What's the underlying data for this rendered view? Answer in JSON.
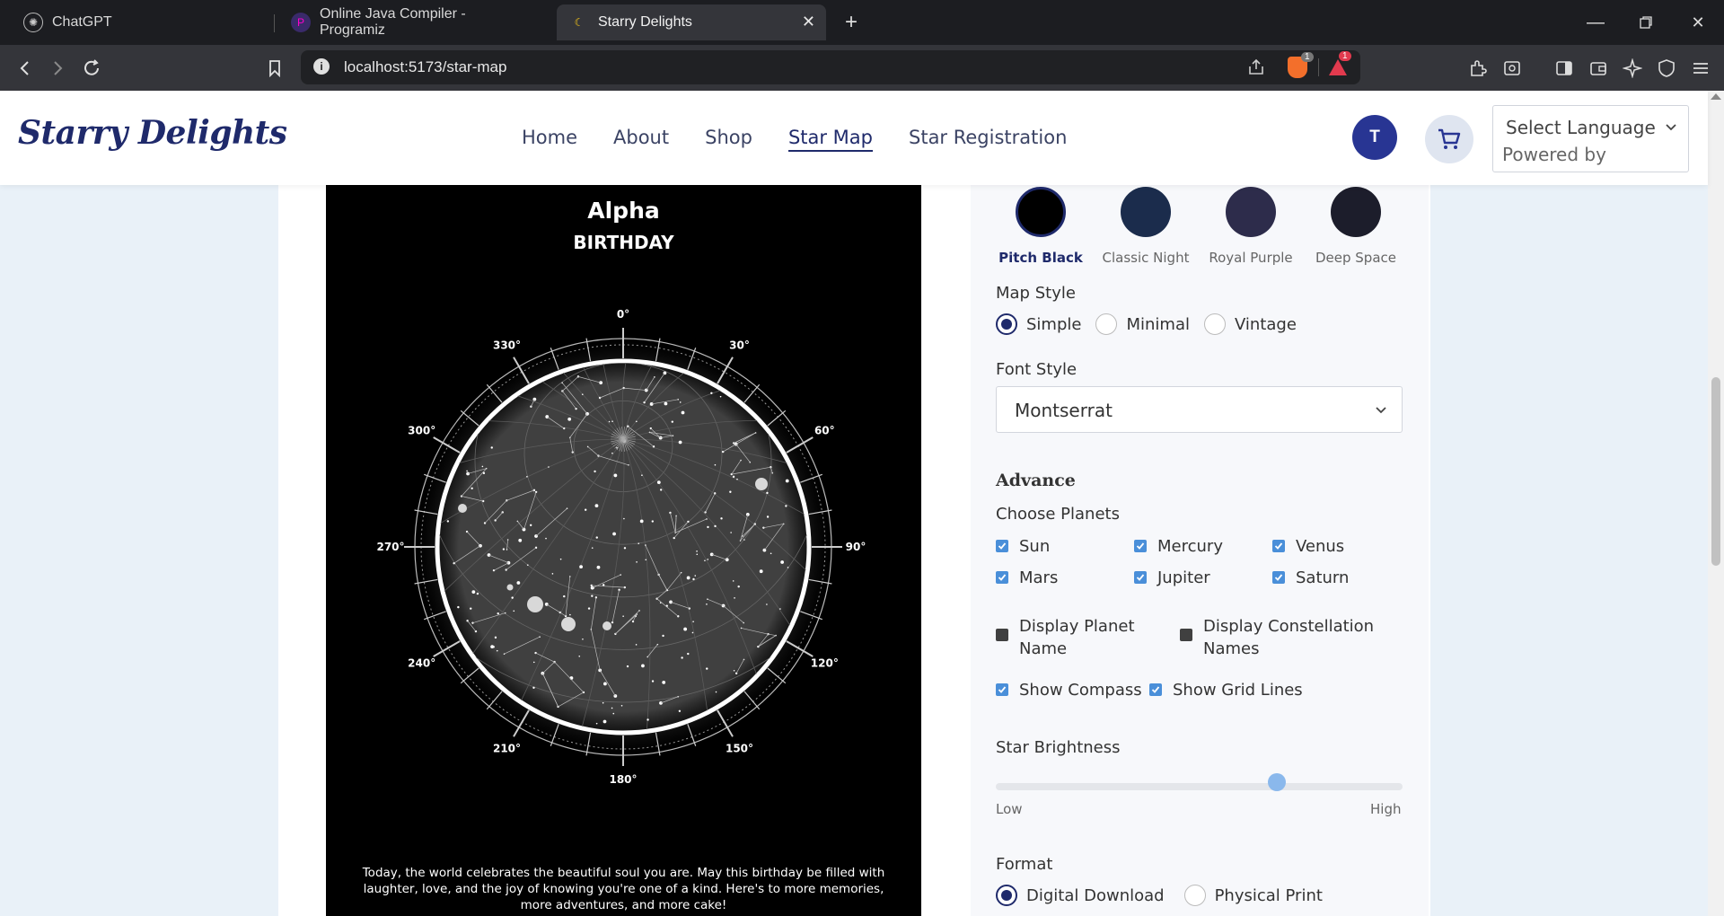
{
  "browser": {
    "tabs": [
      {
        "title": "ChatGPT"
      },
      {
        "title": "Online Java Compiler - Programiz"
      },
      {
        "title": "Starry Delights"
      }
    ],
    "url": "localhost:5173/star-map",
    "brave_badge": "1",
    "alert_badge": "1"
  },
  "site": {
    "logo": "Starry Delights",
    "nav": [
      "Home",
      "About",
      "Shop",
      "Star Map",
      "Star Registration"
    ],
    "active_nav": "Star Map",
    "avatar_letter": "T",
    "language_select": "Select Language",
    "powered_by": "Powered by"
  },
  "poster": {
    "title": "Alpha",
    "subtitle": "BIRTHDAY",
    "message": "Today, the world celebrates the beautiful soul you are. May this birthday be filled with laughter, love, and the joy of knowing you're one of a kind. Here's to more memories, more adventures, and more cake!",
    "compass_labels": [
      "0°",
      "30°",
      "60°",
      "90°",
      "120°",
      "150°",
      "180°",
      "210°",
      "240°",
      "270°",
      "300°",
      "330°"
    ]
  },
  "panel": {
    "themes": [
      {
        "label": "Pitch Black",
        "color": "#000000",
        "selected": true
      },
      {
        "label": "Classic Night",
        "color": "#1b2c4c",
        "selected": false
      },
      {
        "label": "Royal Purple",
        "color": "#2d2c4b",
        "selected": false
      },
      {
        "label": "Deep Space",
        "color": "#1c1d2b",
        "selected": false
      }
    ],
    "map_style_label": "Map Style",
    "map_styles": [
      "Simple",
      "Minimal",
      "Vintage"
    ],
    "map_style_selected": "Simple",
    "font_style_label": "Font Style",
    "font_style_value": "Montserrat",
    "advance_label": "Advance",
    "choose_planets_label": "Choose Planets",
    "planets": [
      {
        "label": "Sun",
        "checked": true
      },
      {
        "label": "Mercury",
        "checked": true
      },
      {
        "label": "Venus",
        "checked": true
      },
      {
        "label": "Mars",
        "checked": true
      },
      {
        "label": "Jupiter",
        "checked": true
      },
      {
        "label": "Saturn",
        "checked": true
      }
    ],
    "display_options": [
      {
        "label": "Display Planet Name",
        "checked": false
      },
      {
        "label": "Display Constellation Names",
        "checked": false
      }
    ],
    "view_options": [
      {
        "label": "Show Compass",
        "checked": true
      },
      {
        "label": "Show Grid Lines",
        "checked": true
      }
    ],
    "star_brightness_label": "Star Brightness",
    "star_brightness_value": 0.69,
    "low_label": "Low",
    "high_label": "High",
    "format_label": "Format",
    "formats": [
      "Digital Download",
      "Physical Print"
    ],
    "format_selected": "Digital Download"
  },
  "colors": {
    "brand": "#1f2a6b",
    "avatar_bg": "#283593",
    "checkbox_on": "#4a8fd9",
    "slider_thumb": "#8ab8ec"
  }
}
